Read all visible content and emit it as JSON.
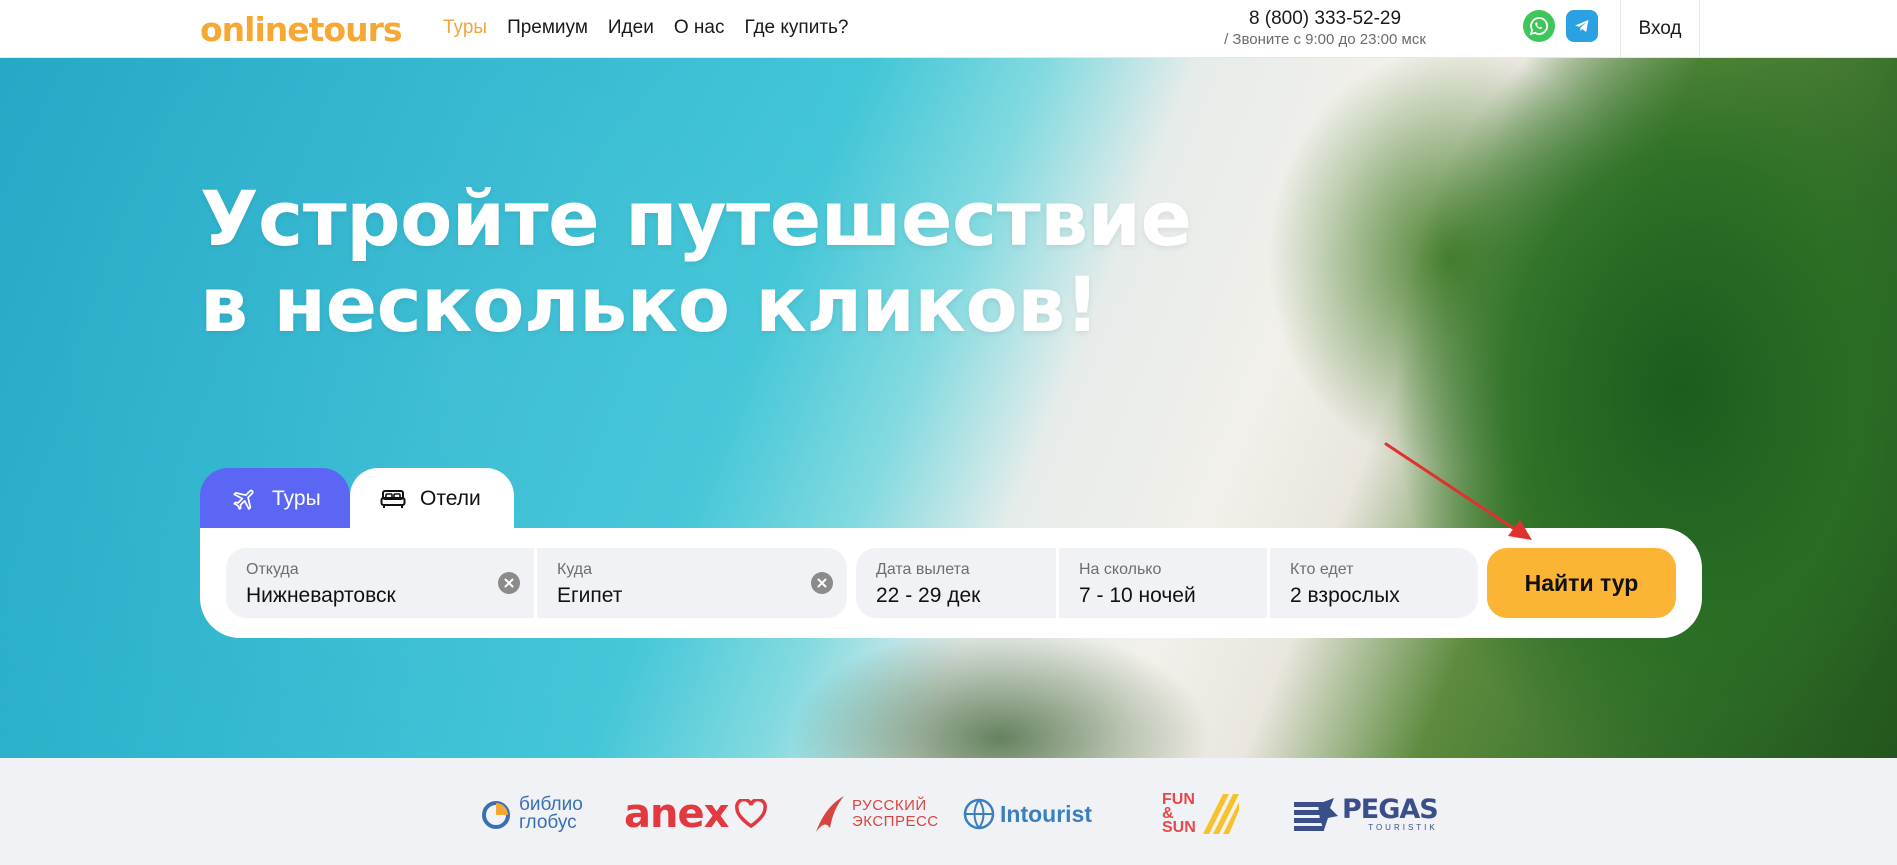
{
  "header": {
    "logo": "onlinetours",
    "nav": [
      "Туры",
      "Премиум",
      "Идеи",
      "О нас",
      "Где купить?"
    ],
    "phone": "8 (800) 333-52-29",
    "hours": "/ Звоните с 9:00 до 23:00 мск",
    "login": "Вход"
  },
  "hero": {
    "headline_line1": "Устройте путешествие",
    "headline_line2": "в несколько кликов!"
  },
  "search": {
    "tabs": [
      "Туры",
      "Отели"
    ],
    "from": {
      "label": "Откуда",
      "value": "Нижневартовск"
    },
    "to": {
      "label": "Куда",
      "value": "Египет"
    },
    "date": {
      "label": "Дата вылета",
      "value": "22 - 29 дек"
    },
    "nights": {
      "label": "На сколько",
      "value": "7 - 10 ночей"
    },
    "who": {
      "label": "Кто едет",
      "value": "2 взрослых"
    },
    "submit": "Найти тур"
  },
  "partners": {
    "biblio_1": "библио",
    "biblio_2": "глобус",
    "anex": "anex",
    "rusexpress_1": "РУССКИЙ",
    "rusexpress_2": "ЭКСПРЕСС",
    "intourist": "Intourist",
    "funsun_1": "FUN",
    "funsun_2": "&",
    "funsun_3": "SUN",
    "pegas_1": "PEGAS",
    "pegas_2": "TOURISTIK"
  },
  "colors": {
    "brand_orange": "#f7a734",
    "tab_active": "#5b66f5",
    "button": "#fbb433",
    "annotation_arrow": "#e0312f"
  }
}
